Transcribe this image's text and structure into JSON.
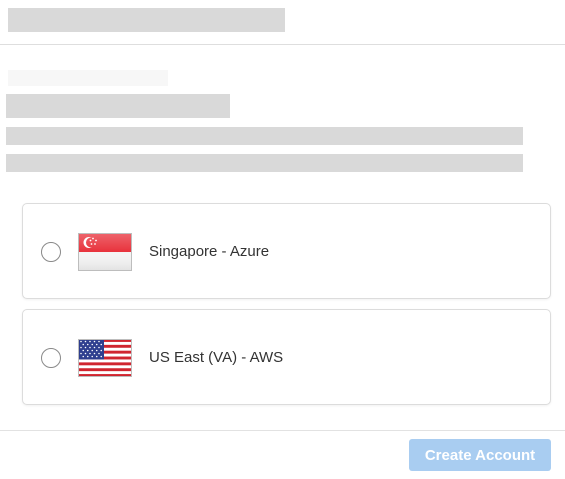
{
  "regions": [
    {
      "label": "Singapore - Azure",
      "flag_icon": "singapore-flag-icon",
      "selected": false
    },
    {
      "label": "US East (VA) - AWS",
      "flag_icon": "us-flag-icon",
      "selected": false
    }
  ],
  "footer": {
    "create_button_label": "Create Account",
    "create_button_enabled": false
  },
  "colors": {
    "button_disabled_bg": "#a9cdf1",
    "placeholder": "#d9d9d9",
    "card_border": "#dcdcdc",
    "label_text": "#333333"
  }
}
